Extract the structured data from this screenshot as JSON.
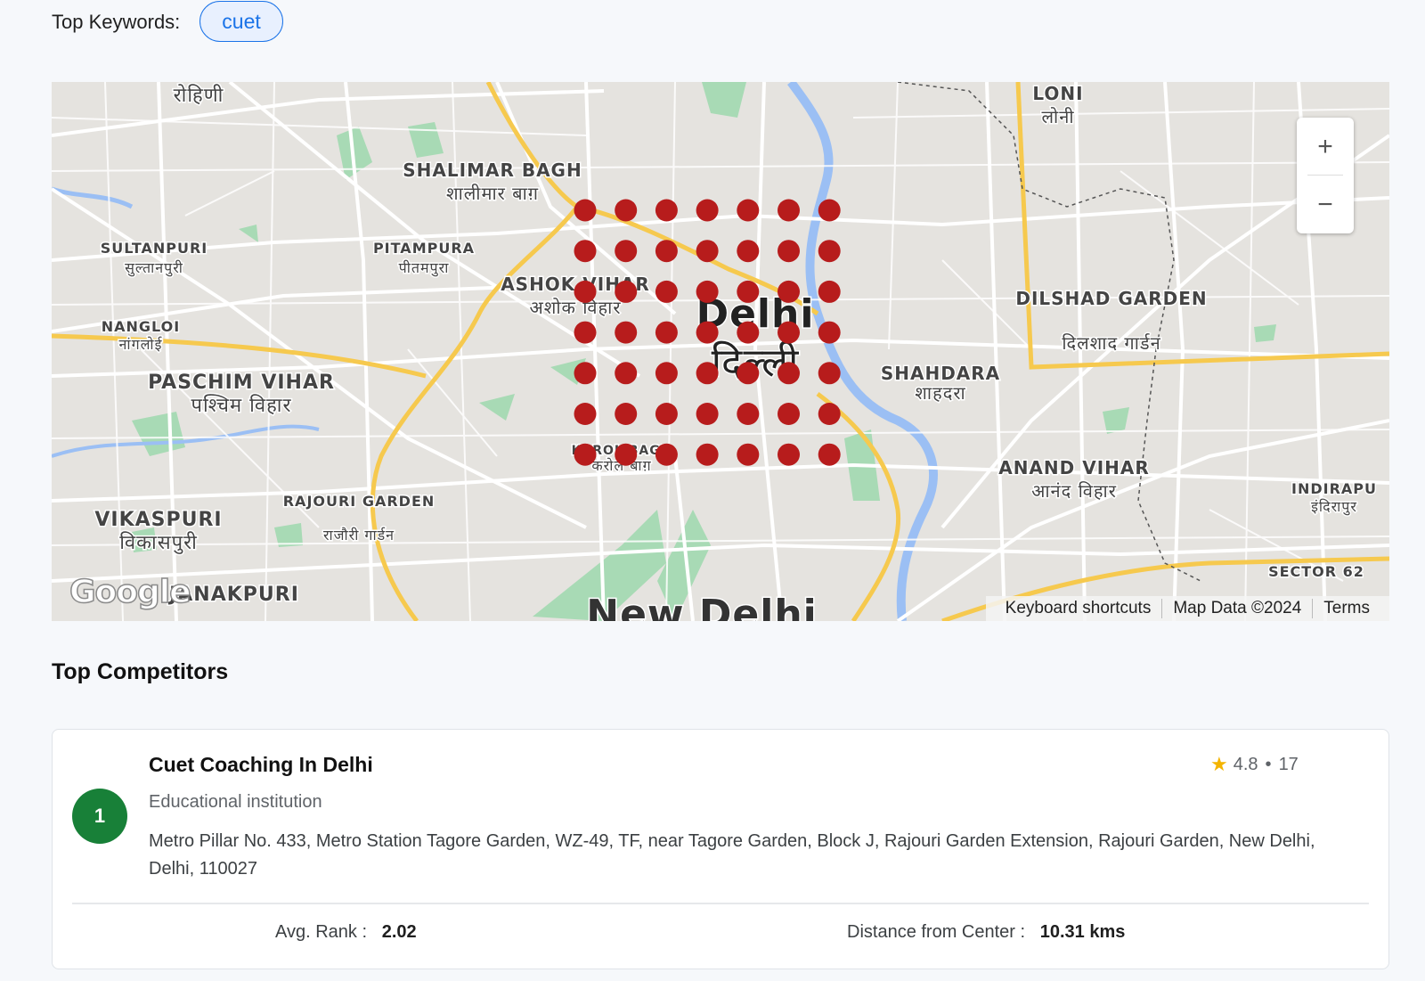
{
  "keywords": {
    "label": "Top Keywords:",
    "active": "cuet"
  },
  "map": {
    "labels": [
      {
        "en": "रोहिणी",
        "hi": ""
      },
      {
        "en": "SHALIMAR BAGH",
        "hi": "शालीमार बाग़"
      },
      {
        "en": "LONI",
        "hi": "लोनी"
      },
      {
        "en": "SULTANPURI",
        "hi": "सुल्तानपुरी"
      },
      {
        "en": "PITAMPURA",
        "hi": "पीतमपुरा"
      },
      {
        "en": "ASHOK VIHAR",
        "hi": "अशोक विहार"
      },
      {
        "en": "DILSHAD GARDEN",
        "hi": "दिलशाद गार्डन"
      },
      {
        "en": "NANGLOI",
        "hi": "नांगलोई"
      },
      {
        "en": "PASCHIM VIHAR",
        "hi": "पश्चिम विहार"
      },
      {
        "en": "SHAHDARA",
        "hi": "शाहदरा"
      },
      {
        "en": "KAROL BAGH",
        "hi": "करोल बाग़"
      },
      {
        "en": "ANAND VIHAR",
        "hi": "आनंद विहार"
      },
      {
        "en": "INDIRAPU",
        "hi": "इंदिरापुर"
      },
      {
        "en": "RAJOURI GARDEN",
        "hi": "राजौरी गार्डन"
      },
      {
        "en": "VIKASPURI",
        "hi": "विकासपुरी"
      },
      {
        "en": "JANAKPURI",
        "hi": ""
      },
      {
        "en": "SECTOR 62",
        "hi": ""
      },
      {
        "en": "New Delhi",
        "hi": ""
      }
    ],
    "city": {
      "en": "Delhi",
      "hi": "दिल्ली"
    },
    "grid": {
      "rows": 7,
      "cols": 7,
      "color": "#b71c1c"
    },
    "zoom_in": "+",
    "zoom_out": "−",
    "logo": "Google",
    "attribution": [
      "Keyboard shortcuts",
      "Map Data ©2024",
      "Terms"
    ],
    "colors": {
      "land": "#e5e3df",
      "road": "#ffffff",
      "highway": "#f6c94e",
      "water": "#9bbff4",
      "park": "#a8dab5"
    }
  },
  "competitors": {
    "title": "Top Competitors",
    "items": [
      {
        "rank": "1",
        "name": "Cuet Coaching In Delhi",
        "category": "Educational institution",
        "address": "Metro Pillar No. 433, Metro Station Tagore Garden, WZ-49, TF, near Tagore Garden, Block J, Rajouri Garden Extension, Rajouri Garden, New Delhi, Delhi, 110027",
        "rating": "4.8",
        "reviews": "17",
        "avg_rank_label": "Avg. Rank :",
        "avg_rank": "2.02",
        "distance_label": "Distance from Center :",
        "distance": "10.31 kms"
      }
    ]
  }
}
